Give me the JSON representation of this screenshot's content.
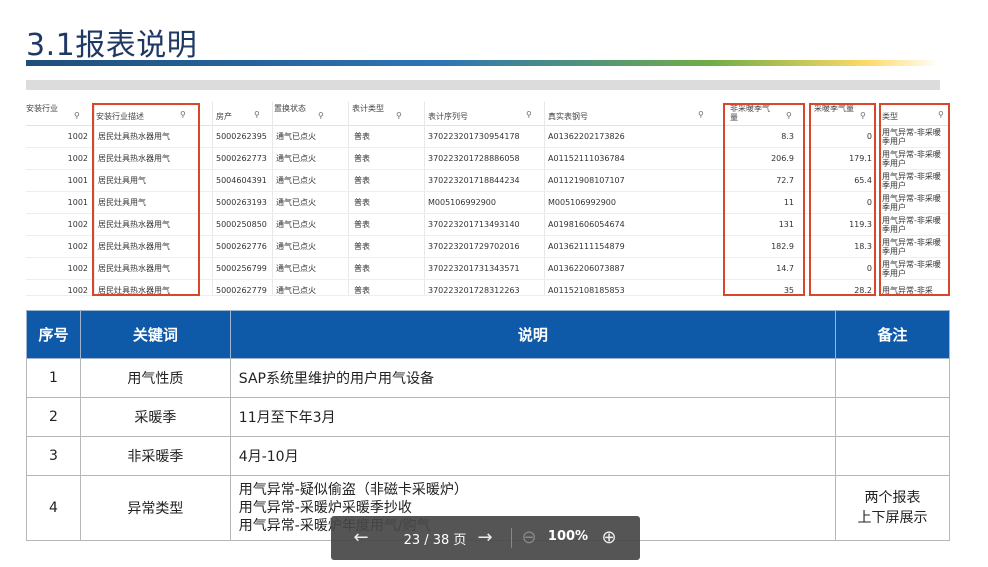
{
  "slide": {
    "title": "3.1报表说明"
  },
  "grid": {
    "headers": [
      "安装行业",
      "安装行业描述",
      "房产",
      "置换状态",
      "表计类型",
      "表计序列号",
      "真实表钢号",
      "非采暖季气量",
      "采暖季气量",
      "类型"
    ],
    "rows": [
      [
        "1002",
        "居民灶具热水器用气",
        "5000262395",
        "通气已点火",
        "普表",
        "370223201730954178",
        "A01362202173826",
        "8.3",
        "0",
        "用气异常-非采暖季用户"
      ],
      [
        "1002",
        "居民灶具热水器用气",
        "5000262773",
        "通气已点火",
        "普表",
        "370223201728886058",
        "A01152111036784",
        "206.9",
        "179.1",
        "用气异常-非采暖季用户"
      ],
      [
        "1001",
        "居民灶具用气",
        "5004604391",
        "通气已点火",
        "普表",
        "370223201718844234",
        "A01121908107107",
        "72.7",
        "65.4",
        "用气异常-非采暖季用户"
      ],
      [
        "1001",
        "居民灶具用气",
        "5000263193",
        "通气已点火",
        "普表",
        "M005106992900",
        "M005106992900",
        "11",
        "0",
        "用气异常-非采暖季用户"
      ],
      [
        "1002",
        "居民灶具热水器用气",
        "5000250850",
        "通气已点火",
        "普表",
        "370223201713493140",
        "A01981606054674",
        "131",
        "119.3",
        "用气异常-非采暖季用户"
      ],
      [
        "1002",
        "居民灶具热水器用气",
        "5000262776",
        "通气已点火",
        "普表",
        "370223201729702016",
        "A01362111154879",
        "182.9",
        "18.3",
        "用气异常-非采暖季用户"
      ],
      [
        "1002",
        "居民灶具热水器用气",
        "5000256799",
        "通气已点火",
        "普表",
        "370223201731343571",
        "A01362206073887",
        "14.7",
        "0",
        "用气异常-非采暖季用户"
      ],
      [
        "1002",
        "居民灶具热水器用气",
        "5000262779",
        "通气已点火",
        "普表",
        "370223201728312263",
        "A01152108185853",
        "35",
        "28.2",
        "用气异常-非采"
      ]
    ]
  },
  "table": {
    "headers": [
      "序号",
      "关键词",
      "说明",
      "备注"
    ],
    "rows": [
      {
        "no": "1",
        "keyword": "用气性质",
        "desc": [
          "SAP系统里维护的用户用气设备"
        ],
        "note": [
          "",
          ""
        ]
      },
      {
        "no": "2",
        "keyword": "采暖季",
        "desc": [
          "11月至下年3月"
        ],
        "note": [
          "",
          ""
        ]
      },
      {
        "no": "3",
        "keyword": "非采暖季",
        "desc": [
          "4月-10月"
        ],
        "note": [
          "",
          ""
        ]
      },
      {
        "no": "4",
        "keyword": "异常类型",
        "desc": [
          "用气异常-疑似偷盗（非磁卡采暖炉）",
          "用气异常-采暖炉采暖季抄收",
          "用气异常-采暖炉年度用气/购气"
        ],
        "note": [
          "两个报表",
          "上下屏展示"
        ]
      }
    ]
  },
  "viewer": {
    "page": "23 / 38 页",
    "zoom": "100%"
  }
}
